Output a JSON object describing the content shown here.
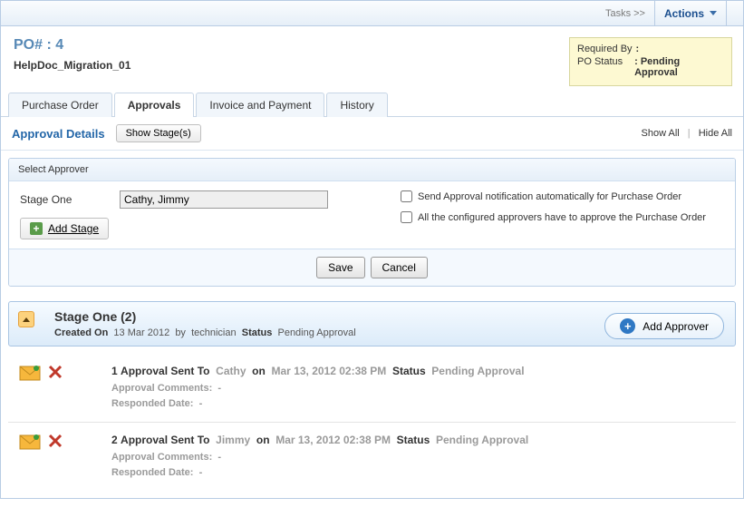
{
  "topbar": {
    "tasks": "Tasks >>",
    "actions": "Actions"
  },
  "header": {
    "po_label": "PO#  :",
    "po_number": "4",
    "doc_name": "HelpDoc_Migration_01",
    "req_by_label": "Required By",
    "req_by_value": ":",
    "po_status_label": "PO Status",
    "po_status_value": ": Pending Approval"
  },
  "tabs": {
    "purchase_order": "Purchase Order",
    "approvals": "Approvals",
    "invoice": "Invoice and Payment",
    "history": "History"
  },
  "subheader": {
    "title": "Approval Details",
    "show_stage": "Show Stage(s)",
    "show_all": "Show All",
    "hide_all": "Hide All"
  },
  "form": {
    "section_title": "Select Approver",
    "stage_label": "Stage One",
    "stage_value": "Cathy, Jimmy",
    "add_stage": "Add Stage",
    "chk_notify": "Send Approval notification automatically for Purchase Order",
    "chk_all_approve": "All the configured approvers have to approve the Purchase Order",
    "save": "Save",
    "cancel": "Cancel"
  },
  "stage": {
    "title": "Stage One (2)",
    "created_on_label": "Created On",
    "created_on_value": "13 Mar 2012",
    "by_label": "by",
    "by_value": "technician",
    "status_label": "Status",
    "status_value": "Pending Approval",
    "add_approver": "Add Approver"
  },
  "approvals": [
    {
      "num": "1",
      "sent_to_label": "Approval Sent To",
      "sent_to": "Cathy",
      "on_label": "on",
      "on_value": "Mar 13, 2012 02:38 PM",
      "status_label": "Status",
      "status_value": "Pending Approval",
      "comments_label": "Approval Comments:",
      "comments_value": "-",
      "responded_label": "Responded Date:",
      "responded_value": "-"
    },
    {
      "num": "2",
      "sent_to_label": "Approval Sent To",
      "sent_to": "Jimmy",
      "on_label": "on",
      "on_value": "Mar 13, 2012 02:38 PM",
      "status_label": "Status",
      "status_value": "Pending Approval",
      "comments_label": "Approval Comments:",
      "comments_value": "-",
      "responded_label": "Responded Date:",
      "responded_value": "-"
    }
  ]
}
